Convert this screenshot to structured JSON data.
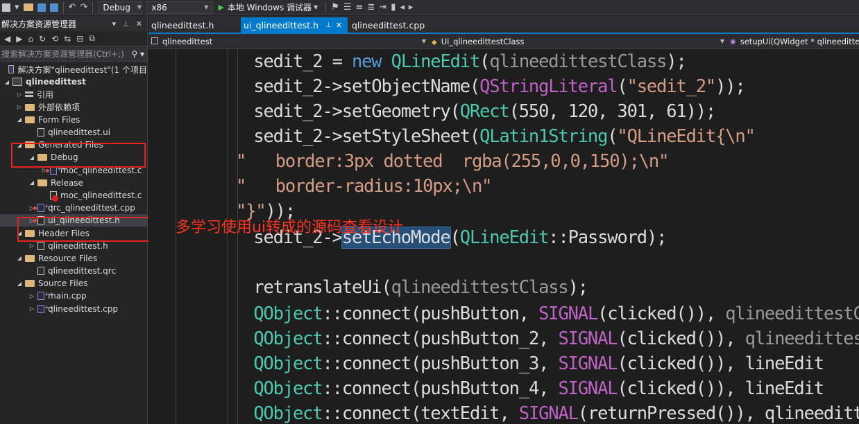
{
  "toolbar": {
    "config": "Debug",
    "platform": "x86",
    "run_label": "本地 Windows 调试器"
  },
  "explorer": {
    "title": "解决方案资源管理器",
    "search_placeholder": "搜索解决方案资源管理器(Ctrl+;)",
    "tree": [
      {
        "label": "解决方案\"qlineedittest\"(1 个项目",
        "depth": 0,
        "icon": "solution-icon",
        "expander": ""
      },
      {
        "label": "qlineedittest",
        "depth": 0,
        "icon": "project-icon",
        "expander": "open",
        "bold": true
      },
      {
        "label": "引用",
        "depth": 1,
        "icon": "references-icon",
        "expander": "closed"
      },
      {
        "label": "外部依赖项",
        "depth": 1,
        "icon": "folder-icon",
        "expander": "closed"
      },
      {
        "label": "Form Files",
        "depth": 1,
        "icon": "folder-icon",
        "expander": "open"
      },
      {
        "label": "qlineedittest.ui",
        "depth": 2,
        "icon": "file-icon",
        "expander": ""
      },
      {
        "label": "Generated Files",
        "depth": 1,
        "icon": "folder-icon",
        "expander": "open"
      },
      {
        "label": "Debug",
        "depth": 2,
        "icon": "folder-icon",
        "expander": "open"
      },
      {
        "label": "moc_qlineedittest.c",
        "depth": 3,
        "icon": "cpp-file-icon",
        "expander": "closed",
        "red": true
      },
      {
        "label": "Release",
        "depth": 2,
        "icon": "folder-icon",
        "expander": "open"
      },
      {
        "label": "moc_qlineedittest.c",
        "depth": 3,
        "icon": "excluded-file-icon",
        "expander": "",
        "red": true
      },
      {
        "label": "qrc_qlineedittest.cpp",
        "depth": 2,
        "icon": "cpp-file-icon",
        "expander": "closed",
        "red": true
      },
      {
        "label": "ui_qlineedittest.h",
        "depth": 2,
        "icon": "header-file-icon",
        "expander": "closed",
        "red": true,
        "selected": true
      },
      {
        "label": "Header Files",
        "depth": 1,
        "icon": "folder-icon",
        "expander": "open"
      },
      {
        "label": "qlineedittest.h",
        "depth": 2,
        "icon": "header-file-icon",
        "expander": "closed"
      },
      {
        "label": "Resource Files",
        "depth": 1,
        "icon": "folder-icon",
        "expander": "open"
      },
      {
        "label": "qlineedittest.qrc",
        "depth": 2,
        "icon": "file-icon",
        "expander": ""
      },
      {
        "label": "Source Files",
        "depth": 1,
        "icon": "folder-icon",
        "expander": "open"
      },
      {
        "label": "main.cpp",
        "depth": 2,
        "icon": "cpp-file-icon",
        "expander": "closed"
      },
      {
        "label": "qlineedittest.cpp",
        "depth": 2,
        "icon": "cpp-file-icon",
        "expander": "closed"
      }
    ]
  },
  "annotation": {
    "text": "多学习使用ui转成的源码查看设计",
    "color": "#e8231f"
  },
  "tabs": [
    {
      "label": "qlineedittest.h",
      "active": false
    },
    {
      "label": "ui_qlineedittest.h",
      "active": true
    },
    {
      "label": "qlineedittest.cpp",
      "active": false
    }
  ],
  "navbar": {
    "project": "qlineedittest",
    "class": "Ui_qlineedittestClass",
    "member": "setupUi(QWidget * qlineedittestClass)"
  },
  "code_lines": [
    [
      {
        "t": "        sedit_2 = "
      },
      {
        "t": "new",
        "c": "kw"
      },
      {
        "t": " "
      },
      {
        "t": "QLineEdit",
        "c": "ty"
      },
      {
        "t": "("
      },
      {
        "t": "qlineedittestClass",
        "c": "gr"
      },
      {
        "t": ");"
      }
    ],
    [
      {
        "t": "        sedit_2->setObjectName("
      },
      {
        "t": "QStringLiteral",
        "c": "mc"
      },
      {
        "t": "("
      },
      {
        "t": "\"sedit_2\"",
        "c": "st"
      },
      {
        "t": "));"
      }
    ],
    [
      {
        "t": "        sedit_2->setGeometry("
      },
      {
        "t": "QRect",
        "c": "ty"
      },
      {
        "t": "(550, 120, 301, 61));"
      }
    ],
    [
      {
        "t": "        sedit_2->setStyleSheet("
      },
      {
        "t": "QLatin1String",
        "c": "ty"
      },
      {
        "t": "("
      },
      {
        "t": "\"QLineEdit{\\n\"",
        "c": "st"
      }
    ],
    [
      {
        "t": "\"   border:3px dotted  rgba(255,0,0,150);\\n\"",
        "c": "st"
      }
    ],
    [
      {
        "t": "\"   border-radius:10px;\\n\"",
        "c": "st"
      }
    ],
    [
      {
        "t": "\"}\"",
        "c": "st"
      },
      {
        "t": "));"
      }
    ],
    [
      {
        "t": "        sedit_2->"
      },
      {
        "t": "setEchoMode",
        "c": "hl"
      },
      {
        "t": "("
      },
      {
        "t": "QLineEdit",
        "c": "ty"
      },
      {
        "t": "::Password);"
      }
    ],
    [
      {
        "t": ""
      }
    ],
    [
      {
        "t": "        retranslateUi("
      },
      {
        "t": "qlineedittestClass",
        "c": "gr"
      },
      {
        "t": ");"
      }
    ],
    [
      {
        "t": "        "
      },
      {
        "t": "QObject",
        "c": "ty"
      },
      {
        "t": "::connect(pushButton, "
      },
      {
        "t": "SIGNAL",
        "c": "mc"
      },
      {
        "t": "(clicked()), "
      },
      {
        "t": "qlineedittestClass",
        "c": "gr"
      }
    ],
    [
      {
        "t": "        "
      },
      {
        "t": "QObject",
        "c": "ty"
      },
      {
        "t": "::connect(pushButton_2, "
      },
      {
        "t": "SIGNAL",
        "c": "mc"
      },
      {
        "t": "(clicked()), "
      },
      {
        "t": "qlineedittestClass",
        "c": "gr"
      }
    ],
    [
      {
        "t": "        "
      },
      {
        "t": "QObject",
        "c": "ty"
      },
      {
        "t": "::connect(pushButton_3, "
      },
      {
        "t": "SIGNAL",
        "c": "mc"
      },
      {
        "t": "(clicked()), lineEdit"
      }
    ],
    [
      {
        "t": "        "
      },
      {
        "t": "QObject",
        "c": "ty"
      },
      {
        "t": "::connect(pushButton_4, "
      },
      {
        "t": "SIGNAL",
        "c": "mc"
      },
      {
        "t": "(clicked()), lineEdit"
      }
    ],
    [
      {
        "t": "        "
      },
      {
        "t": "QObject",
        "c": "ty"
      },
      {
        "t": "::connect(textEdit, "
      },
      {
        "t": "SIGNAL",
        "c": "mc"
      },
      {
        "t": "(returnPressed()), qlineedittestClass"
      }
    ]
  ]
}
